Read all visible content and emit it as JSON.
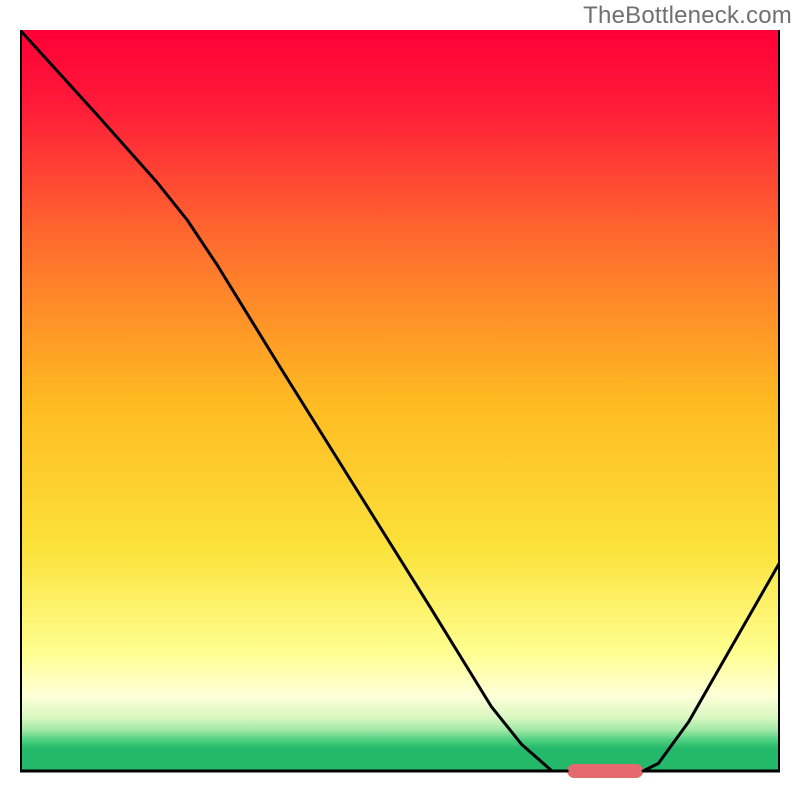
{
  "watermark": "TheBottleneck.com",
  "chart_data": {
    "type": "line",
    "title": "",
    "xlabel": "",
    "ylabel": "",
    "xlim": [
      0,
      100
    ],
    "ylim": [
      0,
      100
    ],
    "gradient_stops": [
      {
        "offset": 0.0,
        "color": "#ff0037"
      },
      {
        "offset": 0.1,
        "color": "#ff1a39"
      },
      {
        "offset": 0.28,
        "color": "#ff6a2e"
      },
      {
        "offset": 0.5,
        "color": "#ffba22"
      },
      {
        "offset": 0.7,
        "color": "#fbe23a"
      },
      {
        "offset": 0.84,
        "color": "#ffff90"
      },
      {
        "offset": 0.9,
        "color": "#fdffd8"
      },
      {
        "offset": 0.928,
        "color": "#d9f7c0"
      },
      {
        "offset": 0.945,
        "color": "#9fe8a6"
      },
      {
        "offset": 0.958,
        "color": "#4fd07f"
      },
      {
        "offset": 0.97,
        "color": "#23b86a"
      },
      {
        "offset": 1.0,
        "color": "#23b86a"
      }
    ],
    "left_curve": [
      {
        "x": 0,
        "y": 100
      },
      {
        "x": 10,
        "y": 89
      },
      {
        "x": 18,
        "y": 80
      },
      {
        "x": 22,
        "y": 75
      },
      {
        "x": 26,
        "y": 69
      },
      {
        "x": 34,
        "y": 56
      },
      {
        "x": 44,
        "y": 40
      },
      {
        "x": 54,
        "y": 24
      },
      {
        "x": 62,
        "y": 11
      },
      {
        "x": 66,
        "y": 6
      },
      {
        "x": 70,
        "y": 2.5
      },
      {
        "x": 72,
        "y": 2.5
      }
    ],
    "right_curve": [
      {
        "x": 82,
        "y": 2.5
      },
      {
        "x": 84,
        "y": 3.5
      },
      {
        "x": 88,
        "y": 9
      },
      {
        "x": 92,
        "y": 16
      },
      {
        "x": 96,
        "y": 23
      },
      {
        "x": 100,
        "y": 30
      }
    ],
    "marker": {
      "x_start": 72,
      "x_end": 82,
      "y": 2.5,
      "color": "#e46a6f"
    },
    "baseline_y": 2.5,
    "axis_color": "#000000",
    "line_color": "#000000",
    "line_width": 3
  }
}
